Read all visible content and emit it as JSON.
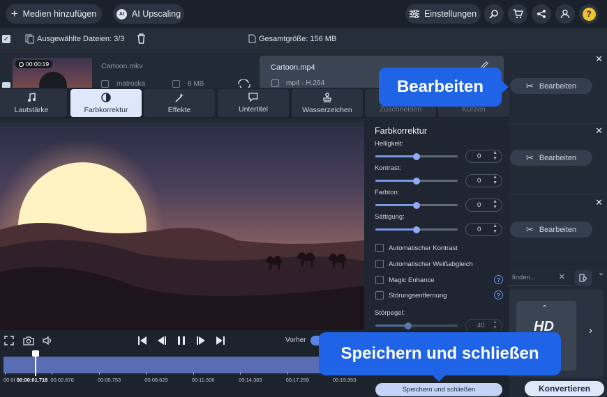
{
  "toolbar": {
    "add_media_label": "Medien hinzufügen",
    "ai_upscaling_label": "AI Upscaling",
    "ai_badge": "AI",
    "settings_label": "Einstellungen"
  },
  "filebar": {
    "selected_label": "Ausgewählte Dateien: 3/3",
    "total_label": "Gesamtgröße: 156 MB"
  },
  "files": [
    {
      "duration": "00:00:19",
      "name": "Cartoon.mkv",
      "format": "matroska",
      "size": "8 MB",
      "output_name": "Cartoon.mp4",
      "output_codec": "mp4 · H.264",
      "edit_label": "Bearbeiten"
    },
    {
      "edit_label": "Bearbeiten"
    },
    {
      "edit_label": "Bearbeiten"
    }
  ],
  "tabs": [
    {
      "label": "Lautstärke",
      "icon": "music-note-icon"
    },
    {
      "label": "Farbkorrektur",
      "icon": "color-correction-icon"
    },
    {
      "label": "Effekte",
      "icon": "magic-wand-icon"
    },
    {
      "label": "Untertitel",
      "icon": "speech-bubble-icon"
    },
    {
      "label": "Wasserzeichen",
      "icon": "stamp-icon"
    },
    {
      "label": "Zuschneiden",
      "icon": "crop-icon"
    },
    {
      "label": "Kürzen",
      "icon": "scissors-icon"
    }
  ],
  "panel": {
    "title": "Farbkorrektur",
    "sliders": [
      {
        "label": "Helligkeit:",
        "value": "0",
        "level": 0.5
      },
      {
        "label": "Kontrast:",
        "value": "0",
        "level": 0.5
      },
      {
        "label": "Farbton:",
        "value": "0",
        "level": 0.5
      },
      {
        "label": "Sättigung:",
        "value": "0",
        "level": 0.5
      }
    ],
    "checkboxes": [
      {
        "label": "Automatischer Kontrast",
        "help": false
      },
      {
        "label": "Automatischer Weißabgleich",
        "help": false
      },
      {
        "label": "Magic Enhance",
        "help": true
      },
      {
        "label": "Störungsentfernung",
        "help": true
      }
    ],
    "noise_label": "Störpegel:",
    "noise_value": "40",
    "noise_level": 0.4,
    "save_label": "Speichern und schließen"
  },
  "player": {
    "before_label": "Vorher",
    "current_time": "00:00:01.718",
    "ticks": [
      "00:00",
      "00:02.876",
      "00:05.753",
      "00:08.629",
      "00:11.506",
      "00:14.383",
      "00:17.259",
      "00:19.953"
    ],
    "playhead_fraction": 0.086
  },
  "right": {
    "search_placeholder": "finden...",
    "hd_label": "HD",
    "convert_label": "Konvertieren"
  },
  "callouts": {
    "edit": "Bearbeiten",
    "save": "Speichern und schließen"
  },
  "colors": {
    "accent": "#1f63e6",
    "slider": "#7a98ea",
    "background": "#1f2631"
  }
}
